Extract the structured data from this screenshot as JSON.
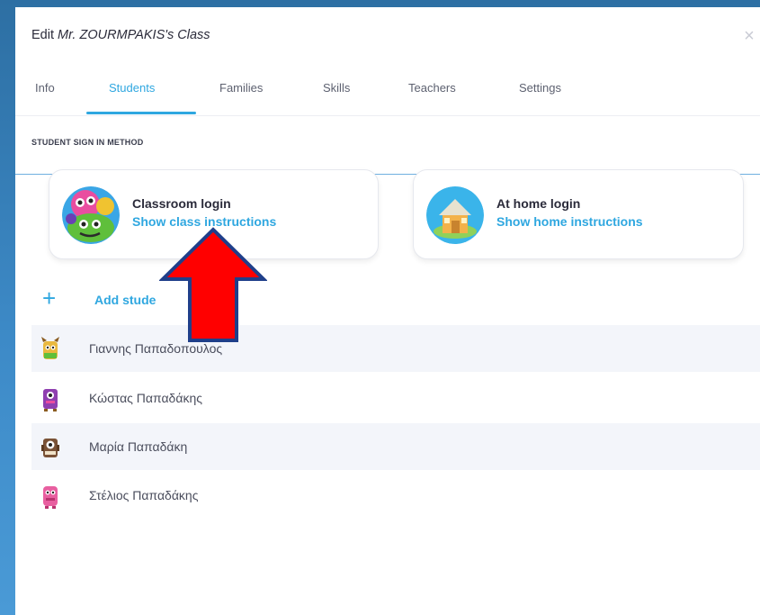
{
  "header": {
    "title_prefix": "Edit",
    "title_owner": "Mr. ZOURMPAKIS's Class",
    "close_glyph": "×"
  },
  "tabs": [
    {
      "label": "Info",
      "active": false
    },
    {
      "label": "Students",
      "active": true
    },
    {
      "label": "Families",
      "active": false
    },
    {
      "label": "Skills",
      "active": false
    },
    {
      "label": "Teachers",
      "active": false
    },
    {
      "label": "Settings",
      "active": false
    }
  ],
  "sign_in": {
    "section_label": "STUDENT SIGN IN METHOD",
    "classroom": {
      "title": "Classroom login",
      "link": "Show class instructions",
      "icon": "monsters-avatar-icon"
    },
    "home": {
      "title": "At home login",
      "link": "Show home instructions",
      "icon": "house-avatar-icon"
    }
  },
  "add_student": {
    "label": "Add stude",
    "icon": "plus-icon"
  },
  "students": [
    {
      "name": "Γιαννης Παπαδοπουλος",
      "avatar_color": "#e9b83e"
    },
    {
      "name": "Κώστας Παπαδάκης",
      "avatar_color": "#8f3fb0"
    },
    {
      "name": "Μαρία Παπαδάκη",
      "avatar_color": "#7a5236"
    },
    {
      "name": "Στέλιος Παπαδάκης",
      "avatar_color": "#e85fa0"
    }
  ],
  "colors": {
    "accent": "#2fa7e0",
    "annotation_arrow_fill": "#ff0000",
    "annotation_arrow_stroke": "#1f3f8a"
  }
}
